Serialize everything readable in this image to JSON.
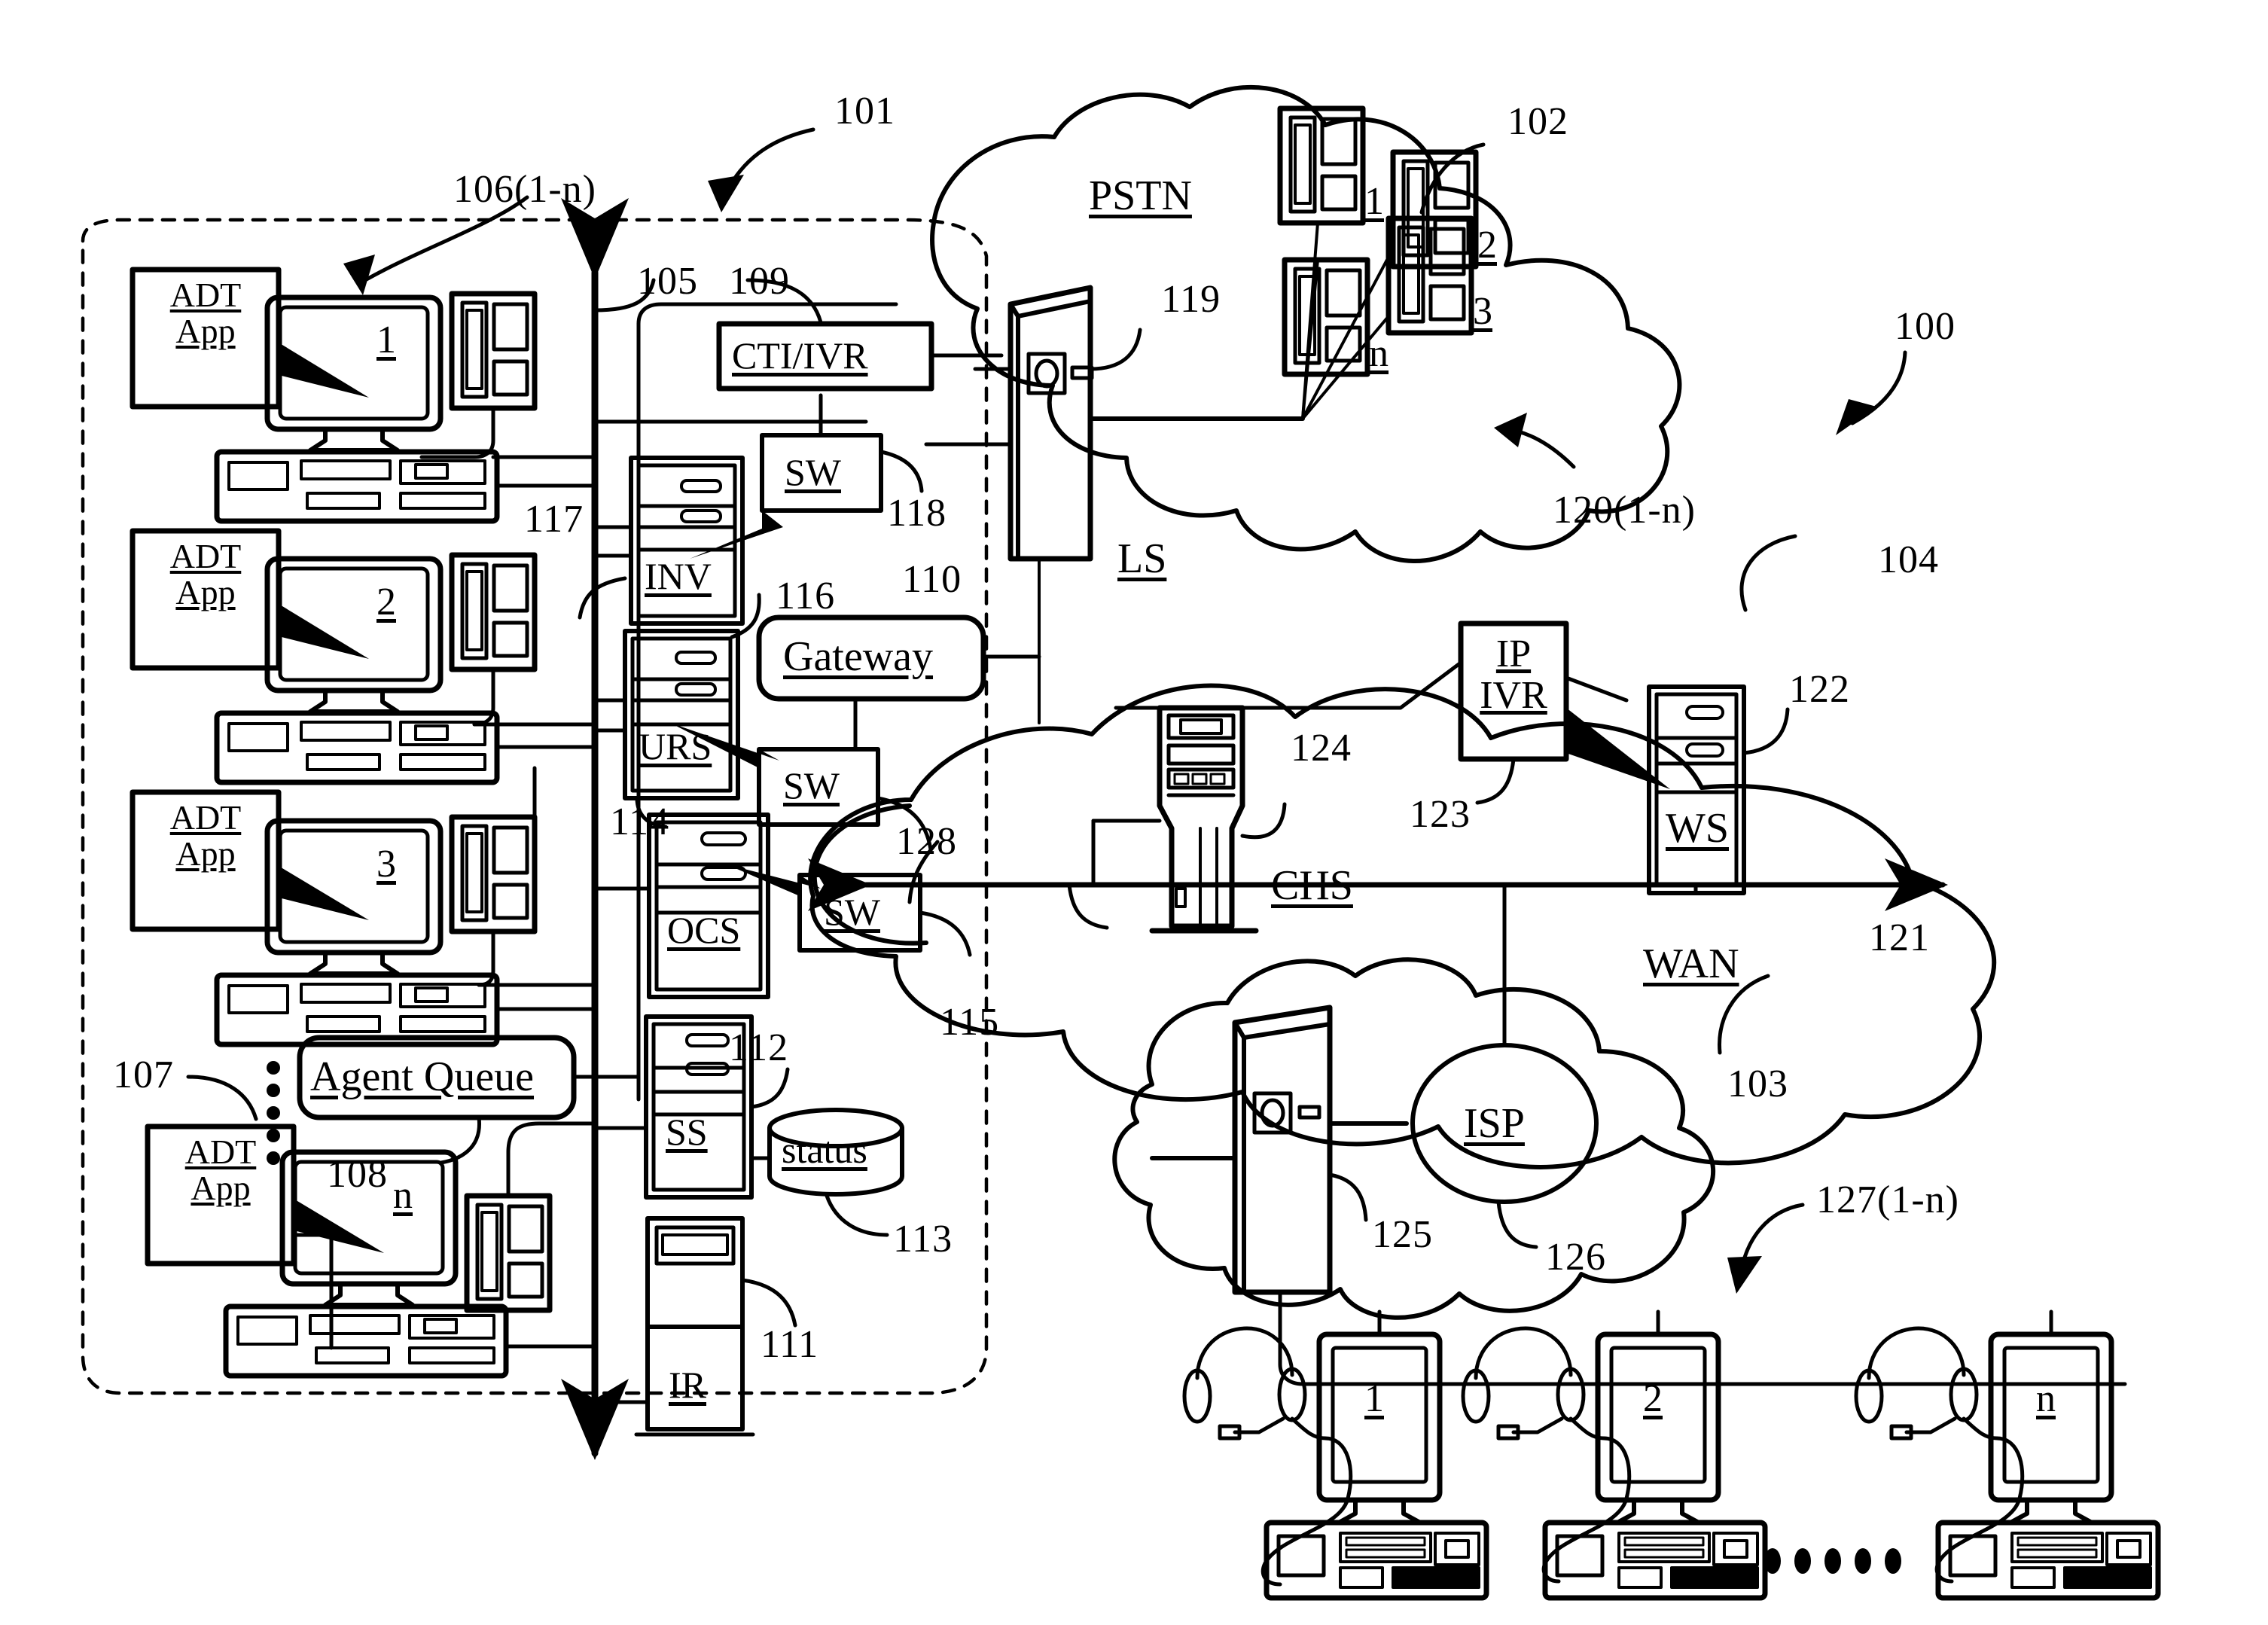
{
  "figure": {
    "overall_ref": "100",
    "contact_center_ref": "101",
    "bus_ref": "105",
    "type": "patent-network-diagram"
  },
  "contact_center": {
    "agents": [
      {
        "app_label_line1": "ADT",
        "app_label_line2": "App",
        "screen_number": "1"
      },
      {
        "app_label_line1": "ADT",
        "app_label_line2": "App",
        "screen_number": "2"
      },
      {
        "app_label_line1": "ADT",
        "app_label_line2": "App",
        "screen_number": "3"
      },
      {
        "app_label_line1": "ADT",
        "app_label_line2": "App",
        "screen_number": "n"
      }
    ],
    "agent_workstations_ref": "106(1-n)",
    "agent_terminal_ref": "107",
    "agent_queue": {
      "label": "Agent Queue",
      "ref": "108"
    },
    "cti_ivr": {
      "label": "CTI/IVR",
      "ref": "109"
    },
    "servers": [
      {
        "label": "INV",
        "ref": "117"
      },
      {
        "label": "URS",
        "ref": "114"
      },
      {
        "label": "OCS",
        "ref": "112"
      },
      {
        "label": "SS",
        "ref": "111"
      },
      {
        "label": "IR",
        "ref": ""
      }
    ],
    "inv_ref": "117",
    "urs_ref": "114",
    "ocs_ref": "112",
    "ss_ref": "",
    "ir_ref": "111",
    "switches": [
      {
        "label": "SW",
        "ref": "118"
      },
      {
        "label": "SW",
        "ref": "115"
      },
      {
        "label": "SW",
        "ref": ""
      }
    ],
    "sw_top_ref": "118",
    "sw_mid_ref": "",
    "sw_low_ref": "115",
    "gateway": {
      "label": "Gateway",
      "ref": "116"
    },
    "gateway_link_ref": "110",
    "status_db": {
      "label": "status",
      "ref": "113"
    },
    "vertical_dots": "•••••"
  },
  "pstn": {
    "cloud_label": "PSTN",
    "cloud_ref": "102",
    "local_switch": {
      "label": "LS",
      "ref": "119"
    },
    "phones_ref": "120(1-n)",
    "phones": [
      "1",
      "2",
      "3",
      "n"
    ]
  },
  "wan": {
    "cloud_label": "WAN",
    "cloud_ref": "104",
    "bus_ref": "121",
    "chs": {
      "label": "CHS",
      "ref": "124"
    },
    "ip_ivr": {
      "label_line1": "IP",
      "label_line2": "IVR",
      "ref": "123"
    },
    "ws": {
      "label": "WS",
      "ref": "122"
    },
    "link_128_ref": "128"
  },
  "internet": {
    "cloud_ref": "103",
    "isp": {
      "label": "ISP",
      "ref": "126"
    },
    "edge_server_ref": "125",
    "clients_ref": "127(1-n)",
    "clients": [
      "1",
      "2",
      "n"
    ],
    "ellipsis": "• • • • •"
  }
}
